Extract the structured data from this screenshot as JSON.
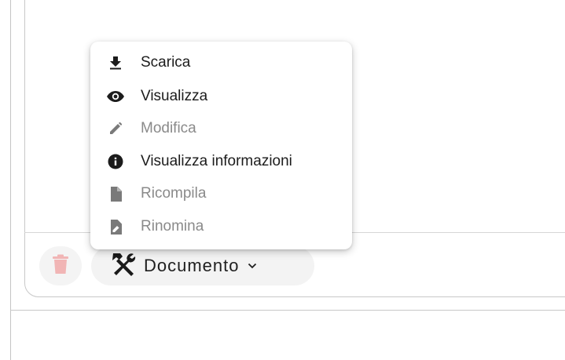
{
  "menu": {
    "items": [
      {
        "label": "Scarica",
        "icon": "download-icon",
        "enabled": true
      },
      {
        "label": "Visualizza",
        "icon": "eye-icon",
        "enabled": true
      },
      {
        "label": "Modifica",
        "icon": "pencil-icon",
        "enabled": false
      },
      {
        "label": "Visualizza informazioni",
        "icon": "info-icon",
        "enabled": true
      },
      {
        "label": "Ricompila",
        "icon": "file-icon",
        "enabled": false
      },
      {
        "label": "Rinomina",
        "icon": "file-rename-icon",
        "enabled": false
      }
    ]
  },
  "toolbar": {
    "document_label": "Documento",
    "delete_icon": "trash-icon",
    "tools_icon": "tools-icon"
  },
  "colors": {
    "text_enabled": "#1c1c1c",
    "text_disabled": "#8a8a8a",
    "delete_disabled": "#f1b5b5"
  }
}
